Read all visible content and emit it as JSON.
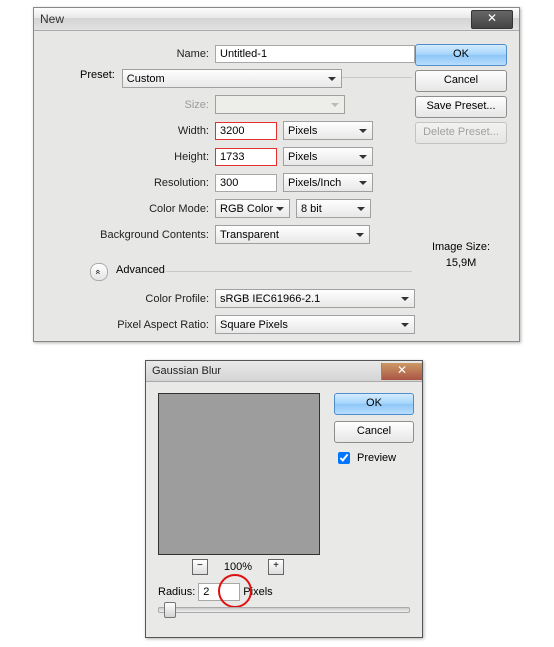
{
  "new_dialog": {
    "title": "New",
    "labels": {
      "name": "Name:",
      "preset": "Preset:",
      "size": "Size:",
      "width": "Width:",
      "height": "Height:",
      "resolution": "Resolution:",
      "color_mode": "Color Mode:",
      "bg_contents": "Background Contents:",
      "advanced": "Advanced",
      "color_profile": "Color Profile:",
      "pixel_aspect": "Pixel Aspect Ratio:"
    },
    "fields": {
      "name": "Untitled-1",
      "preset": "Custom",
      "size": "",
      "width": "3200",
      "width_unit": "Pixels",
      "height": "1733",
      "height_unit": "Pixels",
      "resolution": "300",
      "resolution_unit": "Pixels/Inch",
      "color_mode": "RGB Color",
      "bit_depth": "8 bit",
      "bg_contents": "Transparent",
      "color_profile": "sRGB IEC61966-2.1",
      "pixel_aspect": "Square Pixels"
    },
    "buttons": {
      "ok": "OK",
      "cancel": "Cancel",
      "save_preset": "Save Preset...",
      "delete_preset": "Delete Preset..."
    },
    "image_size_label": "Image Size:",
    "image_size_value": "15,9M",
    "adv_toggle_glyph": "«"
  },
  "blur_dialog": {
    "title": "Gaussian Blur",
    "buttons": {
      "ok": "OK",
      "cancel": "Cancel"
    },
    "preview_label": "Preview",
    "zoom": {
      "minus": "−",
      "pct": "100%",
      "plus": "+"
    },
    "radius_label": "Radius:",
    "radius_value": "2",
    "radius_unit": "Pixels"
  }
}
